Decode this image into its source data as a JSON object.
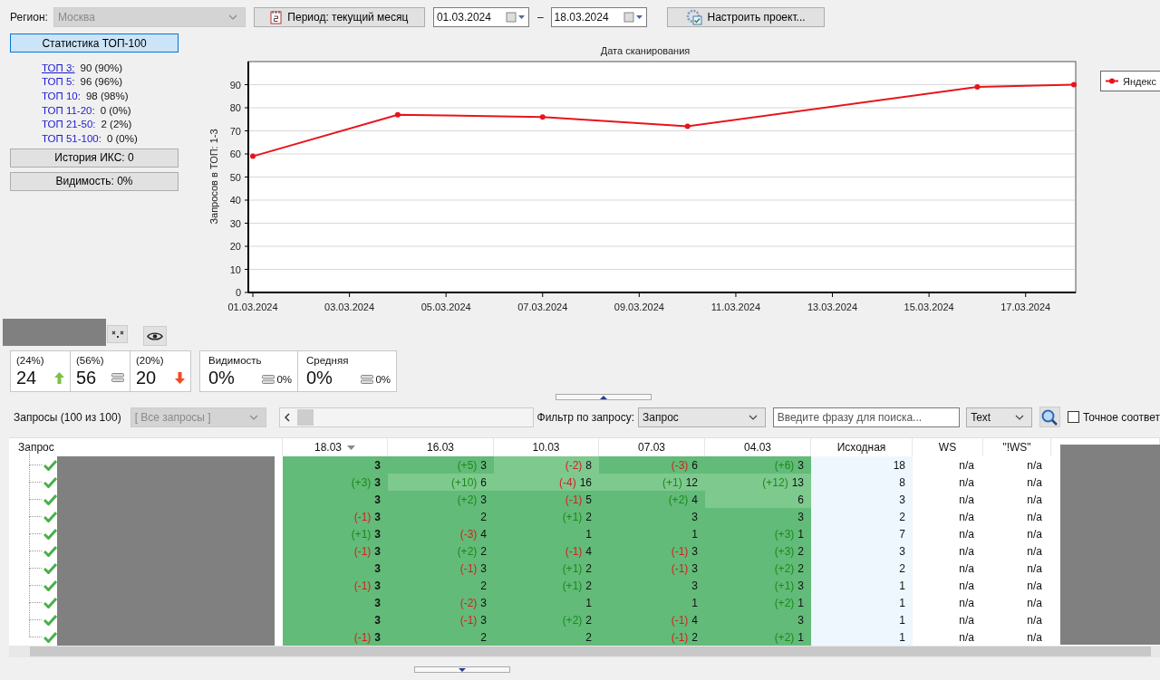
{
  "region": {
    "label": "Регион:",
    "value": "Москва",
    "disabled": true
  },
  "period_button": "Период: текущий месяц",
  "date_from": "01.03.2024",
  "date_separator": "–",
  "date_to": "18.03.2024",
  "settings_button": "Настроить проект...",
  "left_panel": {
    "top_button": {
      "label": "Статистика ТОП-100",
      "selected": true
    },
    "stats": [
      {
        "label": "ТОП 3:",
        "value": "90 (90%)",
        "selected": true
      },
      {
        "label": "ТОП 5:",
        "value": "96 (96%)",
        "selected": false
      },
      {
        "label": "ТОП 10:",
        "value": "98 (98%)",
        "selected": false
      },
      {
        "label": "ТОП 11-20:",
        "value": "0 (0%)",
        "selected": false
      },
      {
        "label": "ТОП 21-50:",
        "value": "2 (2%)",
        "selected": false
      },
      {
        "label": "ТОП 51-100:",
        "value": "0 (0%)",
        "selected": false
      }
    ],
    "buttons": [
      {
        "label": "История ИКС: 0",
        "selected": false
      },
      {
        "label": "Видимость: 0%",
        "selected": false
      }
    ]
  },
  "chart": {
    "chart_data": {
      "type": "line",
      "title": "Дата сканирования",
      "ylabel": "Запросов в ТОП: 1-3",
      "categories": [
        "01.03.2024",
        null,
        "03.03.2024",
        null,
        "05.03.2024",
        null,
        "07.03.2024",
        null,
        "09.03.2024",
        null,
        "11.03.2024",
        null,
        "13.03.2024",
        null,
        "15.03.2024",
        null,
        "17.03.2024",
        null
      ],
      "grid": true,
      "series": [
        {
          "name": "Яндекс",
          "color": "#e8141b",
          "marker": "circle",
          "values": [
            59,
            null,
            null,
            77,
            null,
            null,
            76,
            null,
            null,
            72,
            null,
            null,
            null,
            null,
            null,
            89,
            null,
            90
          ]
        }
      ],
      "ylim": [
        0,
        100
      ],
      "yticks": [
        0,
        10,
        20,
        30,
        40,
        50,
        60,
        70,
        80,
        90
      ]
    }
  },
  "trend_cards": [
    {
      "percent": "(24%)",
      "value": "24",
      "kind": "up"
    },
    {
      "percent": "(56%)",
      "value": "56",
      "kind": "flat"
    },
    {
      "percent": "(20%)",
      "value": "20",
      "kind": "down"
    }
  ],
  "metric_cards": [
    {
      "label": "Видимость",
      "value": "0%",
      "kind": "flat",
      "change": "0%"
    },
    {
      "label": "Средняя",
      "value": "0%",
      "kind": "flat",
      "change": "0%"
    }
  ],
  "filter": {
    "count_label": "Запросы (100 из 100)",
    "group_select": {
      "value": "[ Все запросы ]",
      "disabled": true
    },
    "filter_label": "Фильтр по запросу:",
    "field_select": "Запрос",
    "search_placeholder": "Введите фразу для поиска...",
    "mode_select": "Text",
    "exact_match": {
      "label": "Точное соответ",
      "checked": false
    }
  },
  "table": {
    "columns": [
      {
        "label": "Запрос",
        "sorted": false
      },
      {
        "label": "18.03",
        "sorted": true
      },
      {
        "label": "16.03",
        "sorted": false
      },
      {
        "label": "10.03",
        "sorted": false
      },
      {
        "label": "07.03",
        "sorted": false
      },
      {
        "label": "04.03",
        "sorted": false
      },
      {
        "label": "Исходная",
        "sorted": false
      },
      {
        "label": "WS",
        "sorted": false
      },
      {
        "label": "\"!WS\"",
        "sorted": false
      }
    ],
    "rows": [
      {
        "positions": [
          {
            "value": "3",
            "light": false
          },
          {
            "change": "(+5)",
            "kind": "up",
            "value": "3",
            "light": false
          },
          {
            "change": "(-2)",
            "kind": "down",
            "value": "8",
            "light": true
          },
          {
            "change": "(-3)",
            "kind": "down",
            "value": "6",
            "light": false
          },
          {
            "change": "(+6)",
            "kind": "up",
            "value": "3",
            "light": false
          }
        ],
        "initial": "18",
        "ws": "n/a",
        "iws": "n/a"
      },
      {
        "positions": [
          {
            "change": "(+3)",
            "kind": "up",
            "value": "3",
            "light": false
          },
          {
            "change": "(+10)",
            "kind": "up",
            "value": "6",
            "light": true
          },
          {
            "change": "(-4)",
            "kind": "down",
            "value": "16",
            "light": true
          },
          {
            "change": "(+1)",
            "kind": "up",
            "value": "12",
            "light": true
          },
          {
            "change": "(+12)",
            "kind": "up",
            "value": "13",
            "light": true
          }
        ],
        "initial": "8",
        "ws": "n/a",
        "iws": "n/a"
      },
      {
        "positions": [
          {
            "value": "3",
            "light": false
          },
          {
            "change": "(+2)",
            "kind": "up",
            "value": "3",
            "light": false
          },
          {
            "change": "(-1)",
            "kind": "down",
            "value": "5",
            "light": false
          },
          {
            "change": "(+2)",
            "kind": "up",
            "value": "4",
            "light": false
          },
          {
            "value": "6",
            "light": true
          }
        ],
        "initial": "3",
        "ws": "n/a",
        "iws": "n/a"
      },
      {
        "positions": [
          {
            "change": "(-1)",
            "kind": "down",
            "value": "3",
            "light": false
          },
          {
            "value": "2",
            "light": false
          },
          {
            "change": "(+1)",
            "kind": "up",
            "value": "2",
            "light": false
          },
          {
            "value": "3",
            "light": false
          },
          {
            "value": "3",
            "light": false
          }
        ],
        "initial": "2",
        "ws": "n/a",
        "iws": "n/a"
      },
      {
        "positions": [
          {
            "change": "(+1)",
            "kind": "up",
            "value": "3",
            "light": false
          },
          {
            "change": "(-3)",
            "kind": "down",
            "value": "4",
            "light": false
          },
          {
            "value": "1",
            "light": false
          },
          {
            "value": "1",
            "light": false
          },
          {
            "change": "(+3)",
            "kind": "up",
            "value": "1",
            "light": false
          }
        ],
        "initial": "7",
        "ws": "n/a",
        "iws": "n/a"
      },
      {
        "positions": [
          {
            "change": "(-1)",
            "kind": "down",
            "value": "3",
            "light": false
          },
          {
            "change": "(+2)",
            "kind": "up",
            "value": "2",
            "light": false
          },
          {
            "change": "(-1)",
            "kind": "down",
            "value": "4",
            "light": false
          },
          {
            "change": "(-1)",
            "kind": "down",
            "value": "3",
            "light": false
          },
          {
            "change": "(+3)",
            "kind": "up",
            "value": "2",
            "light": false
          }
        ],
        "initial": "3",
        "ws": "n/a",
        "iws": "n/a"
      },
      {
        "positions": [
          {
            "value": "3",
            "light": false
          },
          {
            "change": "(-1)",
            "kind": "down",
            "value": "3",
            "light": false
          },
          {
            "change": "(+1)",
            "kind": "up",
            "value": "2",
            "light": false
          },
          {
            "change": "(-1)",
            "kind": "down",
            "value": "3",
            "light": false
          },
          {
            "change": "(+2)",
            "kind": "up",
            "value": "2",
            "light": false
          }
        ],
        "initial": "2",
        "ws": "n/a",
        "iws": "n/a"
      },
      {
        "positions": [
          {
            "change": "(-1)",
            "kind": "down",
            "value": "3",
            "light": false
          },
          {
            "value": "2",
            "light": false
          },
          {
            "change": "(+1)",
            "kind": "up",
            "value": "2",
            "light": false
          },
          {
            "value": "3",
            "light": false
          },
          {
            "change": "(+1)",
            "kind": "up",
            "value": "3",
            "light": false
          }
        ],
        "initial": "1",
        "ws": "n/a",
        "iws": "n/a"
      },
      {
        "positions": [
          {
            "value": "3",
            "light": false
          },
          {
            "change": "(-2)",
            "kind": "down",
            "value": "3",
            "light": false
          },
          {
            "value": "1",
            "light": false
          },
          {
            "value": "1",
            "light": false
          },
          {
            "change": "(+2)",
            "kind": "up",
            "value": "1",
            "light": false
          }
        ],
        "initial": "1",
        "ws": "n/a",
        "iws": "n/a"
      },
      {
        "positions": [
          {
            "value": "3",
            "light": false
          },
          {
            "change": "(-1)",
            "kind": "down",
            "value": "3",
            "light": false
          },
          {
            "change": "(+2)",
            "kind": "up",
            "value": "2",
            "light": false
          },
          {
            "change": "(-1)",
            "kind": "down",
            "value": "4",
            "light": false
          },
          {
            "value": "3",
            "light": false
          }
        ],
        "initial": "1",
        "ws": "n/a",
        "iws": "n/a"
      },
      {
        "positions": [
          {
            "change": "(-1)",
            "kind": "down",
            "value": "3",
            "light": false
          },
          {
            "value": "2",
            "light": false
          },
          {
            "value": "2",
            "light": false
          },
          {
            "change": "(-1)",
            "kind": "down",
            "value": "2",
            "light": false
          },
          {
            "change": "(+2)",
            "kind": "up",
            "value": "1",
            "light": false
          }
        ],
        "initial": "1",
        "ws": "n/a",
        "iws": "n/a"
      }
    ]
  }
}
